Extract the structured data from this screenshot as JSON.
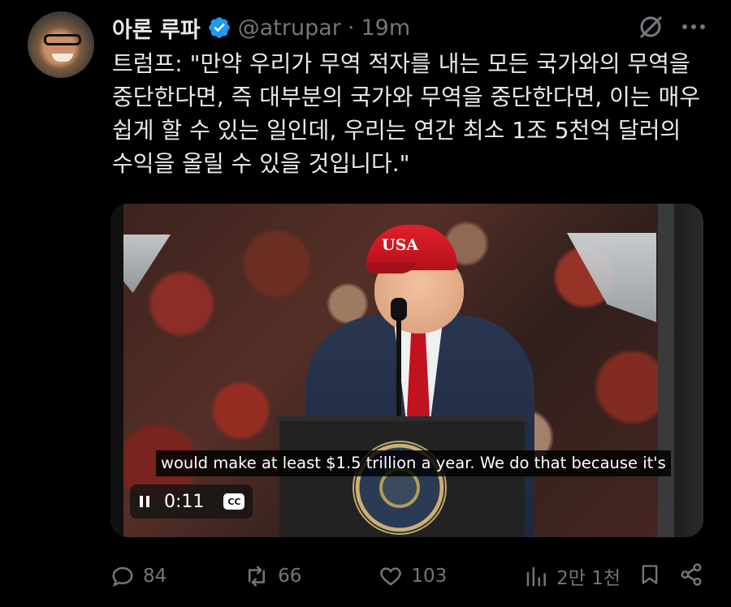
{
  "author": {
    "display_name": "아론 루파",
    "handle": "@atrupar",
    "time_separator": "·",
    "time_ago": "19m",
    "verified": true,
    "avatar_icon": "avatar-photo"
  },
  "tweet": {
    "text": "트럼프: \"만약 우리가 무역 적자를 내는 모든 국가와의 무역을 중단한다면, 즉 대부분의 국가와 무역을 중단한다면, 이는 매우 쉽게 할 수 있는 일인데, 우리는 연간 최소 1조 5천억 달러의 수익을 올릴 수 있을 것입니다.\""
  },
  "video": {
    "caption": "would make at least $1.5 trillion a year. We do that because it's",
    "timestamp": "0:11",
    "cc_label": "CC",
    "cap_text": "USA"
  },
  "actions": {
    "replies": "84",
    "reposts": "66",
    "likes": "103",
    "views": "2만 1천"
  },
  "icons": {
    "verified": "verified-badge-icon",
    "grok": "grok-icon",
    "more": "more-icon",
    "reply": "reply-icon",
    "repost": "repost-icon",
    "like": "like-icon",
    "views": "views-icon",
    "bookmark": "bookmark-icon",
    "share": "share-icon"
  },
  "colors": {
    "background": "#000000",
    "text": "#e7e9ea",
    "muted": "#71767b",
    "verified": "#1d9bf0"
  }
}
